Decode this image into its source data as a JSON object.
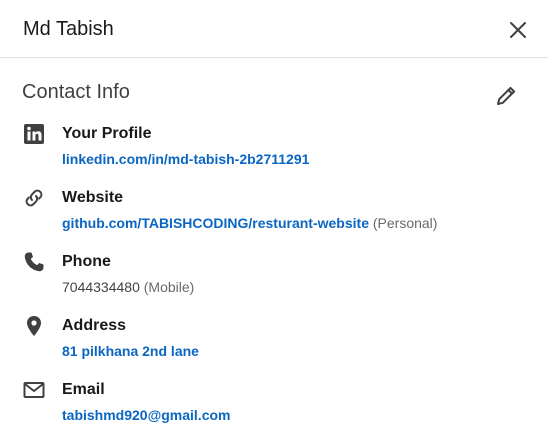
{
  "header": {
    "title": "Md Tabish",
    "close_icon": "close-icon"
  },
  "contact": {
    "title": "Contact Info",
    "edit_icon": "pencil-icon",
    "items": [
      {
        "icon": "linkedin-icon",
        "label": "Your Profile",
        "value": "linkedin.com/in/md-tabish-2b2711291",
        "qualifier": ""
      },
      {
        "icon": "link-icon",
        "label": "Website",
        "value": "github.com/TABISHCODING/resturant-website",
        "qualifier": "(Personal)"
      },
      {
        "icon": "phone-icon",
        "label": "Phone",
        "value": "7044334480",
        "qualifier": "(Mobile)"
      },
      {
        "icon": "location-pin-icon",
        "label": "Address",
        "value": "81 pilkhana 2nd lane",
        "qualifier": ""
      },
      {
        "icon": "envelope-icon",
        "label": "Email",
        "value": "tabishmd920@gmail.com",
        "qualifier": ""
      }
    ]
  },
  "colors": {
    "link": "#0a66c2",
    "text": "#191919",
    "divider": "#e0dfdc"
  }
}
